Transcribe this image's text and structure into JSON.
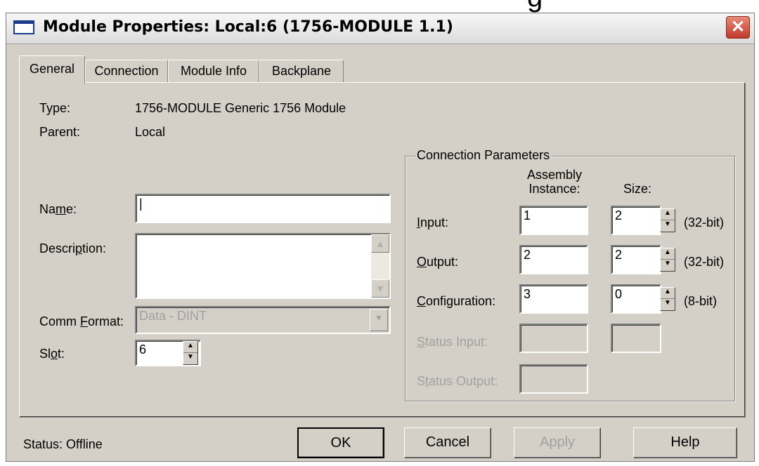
{
  "window": {
    "title": "Module Properties: Local:6 (1756-MODULE 1.1)",
    "cutoff_glyph": "g",
    "close_glyph": "✕"
  },
  "tabs": [
    {
      "label": "General",
      "active": true
    },
    {
      "label": "Connection",
      "active": false
    },
    {
      "label": "Module Info",
      "active": false
    },
    {
      "label": "Backplane",
      "active": false
    }
  ],
  "general": {
    "type_label": "Type:",
    "type_value": "1756-MODULE Generic 1756 Module",
    "parent_label": "Parent:",
    "parent_value": "Local",
    "name_label_pre": "Na",
    "name_label_u": "m",
    "name_label_post": "e:",
    "name_value": "|",
    "description_label_pre": "Descri",
    "description_label_u": "p",
    "description_label_post": "tion:",
    "description_value": "",
    "comm_format_label_pre": "Comm ",
    "comm_format_label_u": "F",
    "comm_format_label_post": "ormat:",
    "comm_format_value": "Data - DINT",
    "slot_label_pre": "Sl",
    "slot_label_u": "o",
    "slot_label_post": "t:",
    "slot_value": "6"
  },
  "connection_parameters": {
    "title": "Connection Parameters",
    "assembly_header_1": "Assembly",
    "assembly_header_2": "Instance:",
    "size_header": "Size:",
    "rows": [
      {
        "label_u": "I",
        "label_rest": "nput:",
        "instance": "1",
        "size": "2",
        "unit": "(32-bit)"
      },
      {
        "label_u": "O",
        "label_rest": "utput:",
        "instance": "2",
        "size": "2",
        "unit": "(32-bit)"
      },
      {
        "label_u": "C",
        "label_rest": "onfiguration:",
        "instance": "3",
        "size": "0",
        "unit": "(8-bit)"
      }
    ],
    "status_input_label_u": "S",
    "status_input_label_rest": "tatus Input:",
    "status_output_label_pre": "S",
    "status_output_label_u": "t",
    "status_output_label_post": "atus Output:"
  },
  "footer": {
    "status": "Status:  Offline",
    "ok": "OK",
    "cancel": "Cancel",
    "apply": "Apply",
    "help": "Help"
  }
}
